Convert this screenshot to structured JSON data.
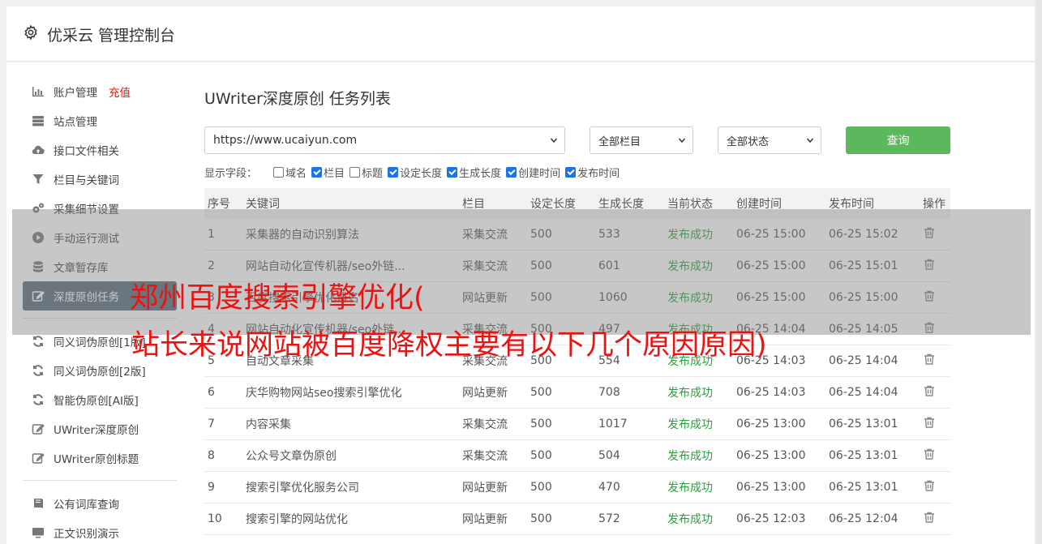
{
  "app": {
    "title": "优采云 管理控制台"
  },
  "sidebar": {
    "items": [
      {
        "label": "账户管理",
        "badge": "充值",
        "icon": "chart-icon"
      },
      {
        "label": "站点管理",
        "icon": "server-icon"
      },
      {
        "label": "接口文件相关",
        "icon": "cloud-upload-icon"
      },
      {
        "label": "栏目与关键词",
        "icon": "filter-icon"
      },
      {
        "label": "采集细节设置",
        "icon": "gears-icon"
      },
      {
        "label": "手动运行测试",
        "icon": "play-icon"
      },
      {
        "label": "文章暂存库",
        "icon": "database-icon"
      },
      {
        "label": "深度原创任务",
        "icon": "edit-icon",
        "active": true
      },
      {
        "label": "同义词伪原创[1版]",
        "icon": "refresh-icon"
      },
      {
        "label": "同义词伪原创[2版]",
        "icon": "refresh-icon"
      },
      {
        "label": "智能伪原创[AI版]",
        "icon": "refresh-icon"
      },
      {
        "label": "UWriter深度原创",
        "icon": "edit-icon"
      },
      {
        "label": "UWriter原创标题",
        "icon": "edit-icon"
      },
      {
        "label": "公有词库查询",
        "icon": "book-icon"
      },
      {
        "label": "正文识别演示",
        "icon": "monitor-icon"
      }
    ]
  },
  "main": {
    "title": "UWriter深度原创 任务列表",
    "site_select": "https://www.ucaiyun.com",
    "category_select": "全部栏目",
    "status_select": "全部状态",
    "query_label": "查询",
    "fields_label": "显示字段：",
    "fields": [
      {
        "label": "域名",
        "checked": false
      },
      {
        "label": "栏目",
        "checked": true
      },
      {
        "label": "标题",
        "checked": false
      },
      {
        "label": "设定长度",
        "checked": true
      },
      {
        "label": "生成长度",
        "checked": true
      },
      {
        "label": "创建时间",
        "checked": true
      },
      {
        "label": "发布时间",
        "checked": true
      }
    ]
  },
  "table": {
    "headers": {
      "no": "序号",
      "keyword": "关键词",
      "category": "栏目",
      "set_len": "设定长度",
      "gen_len": "生成长度",
      "status": "当前状态",
      "created": "创建时间",
      "published": "发布时间",
      "op": "操作"
    },
    "rows": [
      {
        "no": "1",
        "keyword": "采集器的自动识别算法",
        "category": "采集交流",
        "set_len": "500",
        "gen_len": "533",
        "status": "发布成功",
        "created": "06-25 15:00",
        "published": "06-25 15:02"
      },
      {
        "no": "2",
        "keyword": "网站自动化宣传机器/seo外链...",
        "category": "采集交流",
        "set_len": "500",
        "gen_len": "601",
        "status": "发布成功",
        "created": "06-25 15:00",
        "published": "06-25 15:01"
      },
      {
        "no": "3",
        "keyword": "百度搜索引擎优化排名",
        "category": "网站更新",
        "set_len": "500",
        "gen_len": "1060",
        "status": "发布成功",
        "created": "06-25 15:00",
        "published": "06-25 15:00"
      },
      {
        "no": "4",
        "keyword": "网站自动化宣传机器/seo外链...",
        "category": "采集交流",
        "set_len": "500",
        "gen_len": "497",
        "status": "发布成功",
        "created": "06-25 14:04",
        "published": "06-25 14:05"
      },
      {
        "no": "5",
        "keyword": "自动文章采集",
        "category": "采集交流",
        "set_len": "500",
        "gen_len": "554",
        "status": "发布成功",
        "created": "06-25 14:03",
        "published": "06-25 14:04"
      },
      {
        "no": "6",
        "keyword": "庆华购物网站seo搜索引擎优化",
        "category": "网站更新",
        "set_len": "500",
        "gen_len": "708",
        "status": "发布成功",
        "created": "06-25 14:03",
        "published": "06-25 14:04"
      },
      {
        "no": "7",
        "keyword": "内容采集",
        "category": "采集交流",
        "set_len": "500",
        "gen_len": "1017",
        "status": "发布成功",
        "created": "06-25 13:00",
        "published": "06-25 13:01"
      },
      {
        "no": "8",
        "keyword": "公众号文章伪原创",
        "category": "采集交流",
        "set_len": "500",
        "gen_len": "504",
        "status": "发布成功",
        "created": "06-25 13:00",
        "published": "06-25 13:01"
      },
      {
        "no": "9",
        "keyword": "搜索引擎优化服务公司",
        "category": "网站更新",
        "set_len": "500",
        "gen_len": "470",
        "status": "发布成功",
        "created": "06-25 13:00",
        "published": "06-25 13:01"
      },
      {
        "no": "10",
        "keyword": "搜索引擎的网站优化",
        "category": "网站更新",
        "set_len": "500",
        "gen_len": "572",
        "status": "发布成功",
        "created": "06-25 12:03",
        "published": "06-25 12:04"
      }
    ]
  },
  "overlay": {
    "line1": "郑州百度搜索引擎优化(",
    "line2": "站长来说网站被百度降权主要有以下几个原因原因)",
    "text_color": "#ee1111"
  }
}
